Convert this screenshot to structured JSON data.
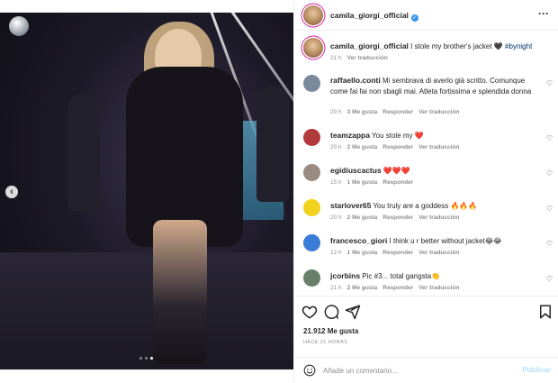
{
  "post": {
    "images_count": 3,
    "active_image": 2
  },
  "header": {
    "username": "camila_giorgi_official",
    "more_icon": "more-horizontal-icon"
  },
  "caption": {
    "username": "camila_giorgi_official",
    "text": "I stole my brother's jacket",
    "emoji": "🖤",
    "hashtag": "#bynight",
    "time": "21 h",
    "translate": "Ver traducción"
  },
  "comments": [
    {
      "username": "raffaello.conti",
      "text": "Mi sembrava di averlo già scritto. Comunque come fai fai non sbagli mai. Atleta fortissima e splendida donna",
      "time": "20 h",
      "likes": "3 Me gusta",
      "reply": "Responder",
      "translate": "Ver traducción",
      "avatar_color": "#7a8a9a"
    },
    {
      "username": "teamzappa",
      "text": "You stole my ❤️",
      "time": "20 h",
      "likes": "2 Me gusta",
      "reply": "Responder",
      "translate": "Ver traducción",
      "avatar_color": "#b23a3a"
    },
    {
      "username": "egidiuscactus",
      "text": "❤️❤️❤️",
      "time": "15 h",
      "likes": "1 Me gusta",
      "reply": "Responder",
      "translate": "",
      "avatar_color": "#9a8c80"
    },
    {
      "username": "starlover65",
      "text": "You truly are a goddess 🔥🔥🔥",
      "time": "20 h",
      "likes": "2 Me gusta",
      "reply": "Responder",
      "translate": "Ver traducción",
      "avatar_color": "#f2d21c"
    },
    {
      "username": "francesco_giori",
      "text": "I think u r better without jacket😂😂",
      "time": "12 h",
      "likes": "1 Me gusta",
      "reply": "Responder",
      "translate": "Ver traducción",
      "avatar_color": "#3a7bd5"
    },
    {
      "username": "jcorbins",
      "text": "Pic #3... total gangsta👏",
      "time": "21 h",
      "likes": "2 Me gusta",
      "reply": "Responder",
      "translate": "Ver traducción",
      "avatar_color": "#6a7f6a"
    }
  ],
  "actions": {
    "likes": "21.912 Me gusta",
    "ago": "HACE 21 HORAS"
  },
  "add_comment": {
    "placeholder": "Añade un comentario...",
    "publish": "Publicar"
  }
}
